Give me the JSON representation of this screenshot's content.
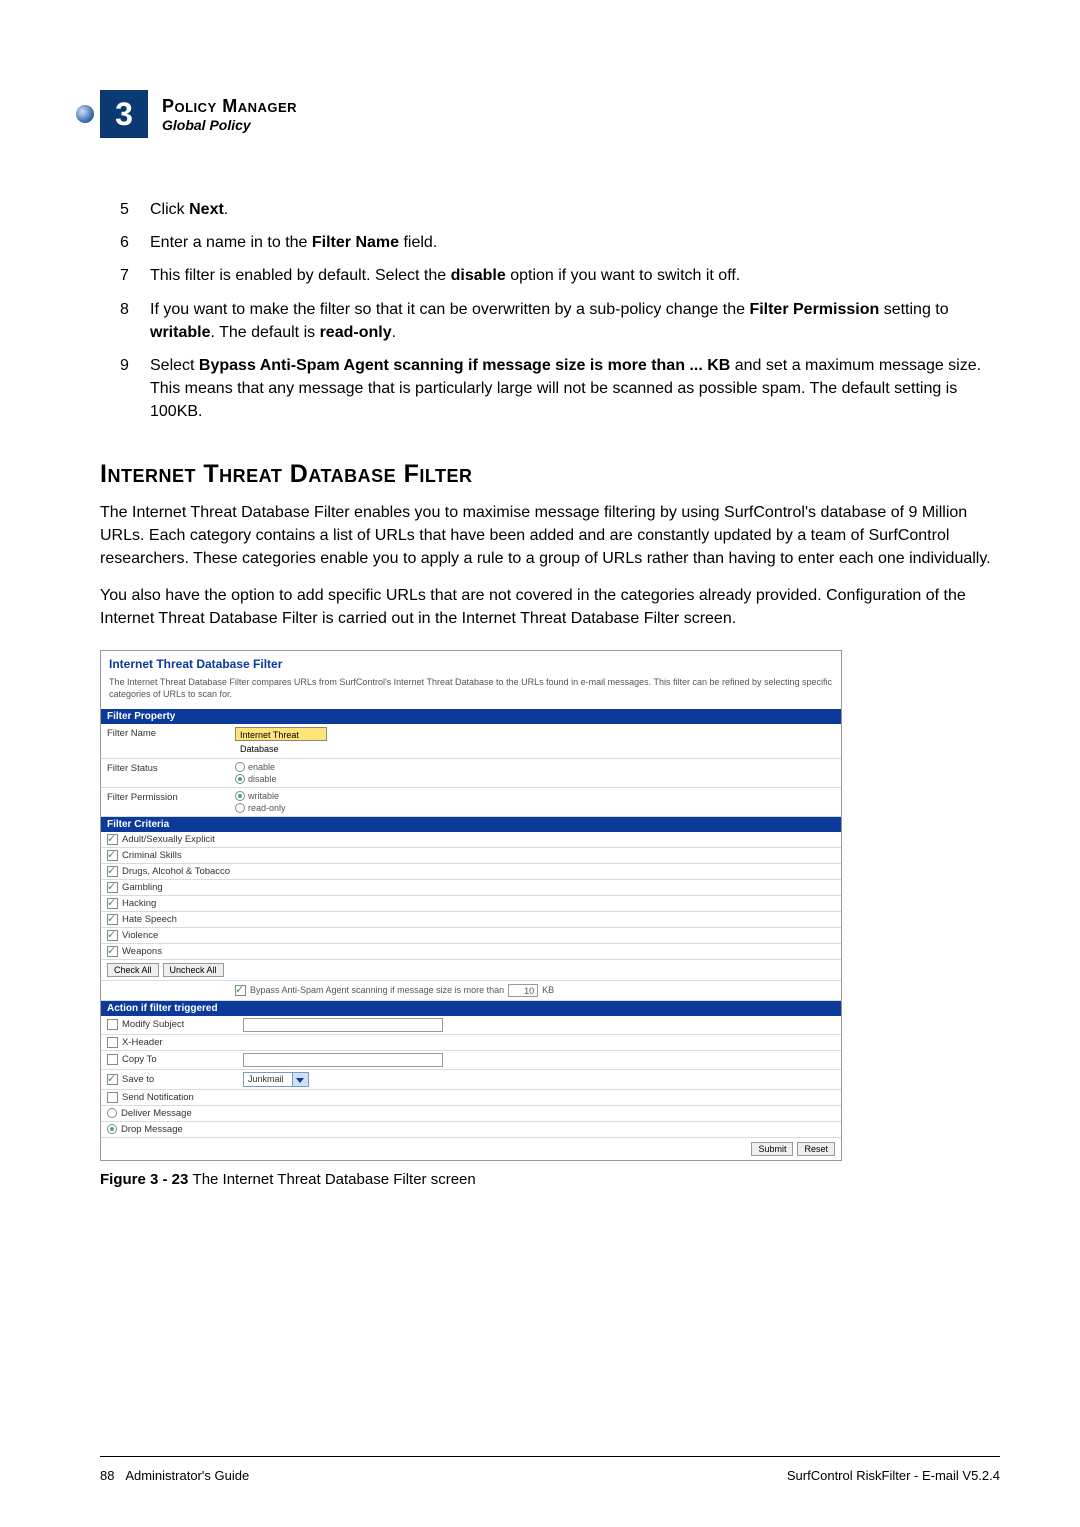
{
  "header": {
    "chapter_number": "3",
    "title": "Policy Manager",
    "subtitle": "Global Policy"
  },
  "steps": [
    {
      "num": "5",
      "html": "Click <b>Next</b>."
    },
    {
      "num": "6",
      "html": "Enter a name in to the <b>Filter Name</b> field."
    },
    {
      "num": "7",
      "html": "This filter is enabled by default. Select the <b>disable</b> option if you want to switch it off."
    },
    {
      "num": "8",
      "html": "If you want to make the filter so that it can be overwritten by a sub-policy change the <b>Filter Permission</b> setting to <b>writable</b>. The default is <b>read-only</b>."
    },
    {
      "num": "9",
      "html": "Select <b>Bypass Anti-Spam Agent scanning if message size is more than ... KB</b> and set a maximum message size. This means that any message that is particularly large will not be scanned as possible spam. The default setting is 100KB."
    }
  ],
  "section_heading": "Internet Threat Database Filter",
  "para1": "The Internet Threat Database Filter enables you to maximise message filtering by using SurfControl's database of 9 Million URLs. Each category contains a list of URLs that have been added and are constantly updated by a team of SurfControl researchers. These categories enable you to apply a rule to a group of URLs rather than having to enter each one individually.",
  "para2": "You also have the option to add specific URLs that are not covered in the categories already provided. Configuration of the Internet Threat Database Filter is carried out in the Internet Threat Database Filter screen.",
  "figure": {
    "panel_title": "Internet Threat Database Filter",
    "panel_desc": "The Internet Threat Database Filter compares URLs from SurfControl's Internet Threat Database to the URLs found in e-mail messages. This filter can be refined by selecting specific categories of URLs to scan for.",
    "filter_property_header": "Filter Property",
    "filter_name_label": "Filter Name",
    "filter_name_value": "Internet Threat Database",
    "filter_status_label": "Filter Status",
    "status_enable": "enable",
    "status_disable": "disable",
    "filter_permission_label": "Filter Permission",
    "perm_writable": "writable",
    "perm_readonly": "read-only",
    "filter_criteria_header": "Filter Criteria",
    "criteria": [
      "Adult/Sexually Explicit",
      "Criminal Skills",
      "Drugs, Alcohol & Tobacco",
      "Gambling",
      "Hacking",
      "Hate Speech",
      "Violence",
      "Weapons"
    ],
    "check_all": "Check All",
    "uncheck_all": "Uncheck All",
    "bypass_text": "Bypass Anti-Spam Agent scanning if message size is more than",
    "bypass_value": "10",
    "bypass_unit": "KB",
    "action_header": "Action if filter triggered",
    "actions": {
      "modify_subject": "Modify Subject",
      "x_header": "X-Header",
      "copy_to": "Copy To",
      "save_to": "Save to",
      "save_to_value": "Junkmail",
      "send_notification": "Send Notification",
      "deliver_message": "Deliver Message",
      "drop_message": "Drop Message"
    },
    "submit": "Submit",
    "reset": "Reset",
    "caption_prefix": "Figure 3 - 23 ",
    "caption_text": "The Internet Threat Database Filter screen"
  },
  "footer": {
    "page": "88",
    "left": "Administrator's Guide",
    "right": "SurfControl RiskFilter - E-mail V5.2.4"
  }
}
